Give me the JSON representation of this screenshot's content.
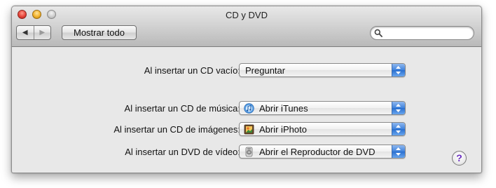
{
  "window": {
    "title": "CD y DVD"
  },
  "toolbar": {
    "back_glyph": "◀",
    "forward_glyph": "▶",
    "show_all_label": "Mostrar todo",
    "search_value": ""
  },
  "settings": {
    "blank_cd": {
      "label": "Al insertar un CD vacío:",
      "value": "Preguntar"
    },
    "music_cd": {
      "label": "Al insertar un CD de música:",
      "value": "Abrir iTunes",
      "icon": "itunes-icon"
    },
    "picture_cd": {
      "label": "Al insertar un CD de imágenes:",
      "value": "Abrir iPhoto",
      "icon": "iphoto-icon"
    },
    "video_dvd": {
      "label": "Al insertar un DVD de vídeo:",
      "value": "Abrir el Reproductor de DVD",
      "icon": "dvd-player-icon"
    }
  },
  "help": {
    "glyph": "?"
  },
  "colors": {
    "popup_arrows": "#3f82dc",
    "close": "#e6443a",
    "minimize": "#f2b22c",
    "help": "#6a2cc0"
  }
}
